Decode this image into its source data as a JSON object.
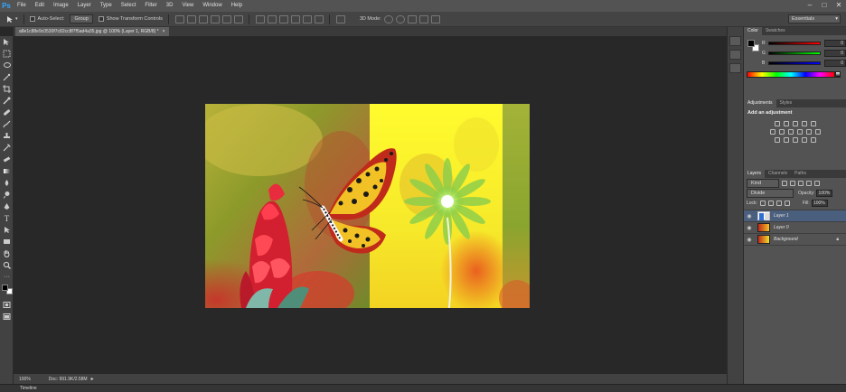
{
  "app": {
    "logo": "Ps"
  },
  "menu": [
    "File",
    "Edit",
    "Image",
    "Layer",
    "Type",
    "Select",
    "Filter",
    "3D",
    "View",
    "Window",
    "Help"
  ],
  "window_controls": [
    "–",
    "□",
    "✕"
  ],
  "options_bar": {
    "auto_select_label": "Auto-Select:",
    "auto_select_value": "Group",
    "show_transform_label": "Show Transform Controls",
    "mode_3d_label": "3D Mode:",
    "workspace": "Essentials"
  },
  "document": {
    "tab_title": "a8e1c88e9c0530f7c82cc8f7f5ad4a35.jpg @ 100% (Layer 1, RGB/8) *",
    "tab_close": "×"
  },
  "status": {
    "zoom": "100%",
    "doc_info": "Doc: 991.9K/2.58M"
  },
  "timeline_label": "Timeline",
  "color_panel": {
    "tabs": [
      "Color",
      "Swatches"
    ],
    "sliders": [
      {
        "label": "R",
        "value": "0",
        "gradient": "linear-gradient(to right,#000,#f00)"
      },
      {
        "label": "G",
        "value": "0",
        "gradient": "linear-gradient(to right,#000,#0f0)"
      },
      {
        "label": "B",
        "value": "0",
        "gradient": "linear-gradient(to right,#000,#00f)"
      }
    ]
  },
  "adjustments_panel": {
    "tabs": [
      "Adjustments",
      "Styles"
    ],
    "heading": "Add an adjustment"
  },
  "layers_panel": {
    "tabs": [
      "Layers",
      "Channels",
      "Paths"
    ],
    "filter_kind": "Kind",
    "blend_mode": "Divide",
    "opacity_label": "Opacity:",
    "opacity_value": "100%",
    "lock_label": "Lock:",
    "fill_label": "Fill:",
    "fill_value": "100%",
    "layers": [
      {
        "name": "Layer 1",
        "selected": true
      },
      {
        "name": "Layer 0",
        "selected": false
      },
      {
        "name": "Background",
        "selected": false,
        "locked": true
      }
    ]
  },
  "colors": {
    "accent": "#31a8ff",
    "selected_layer": "#4a5f7d",
    "panel_bg": "#535353",
    "canvas_bg": "#282828"
  }
}
